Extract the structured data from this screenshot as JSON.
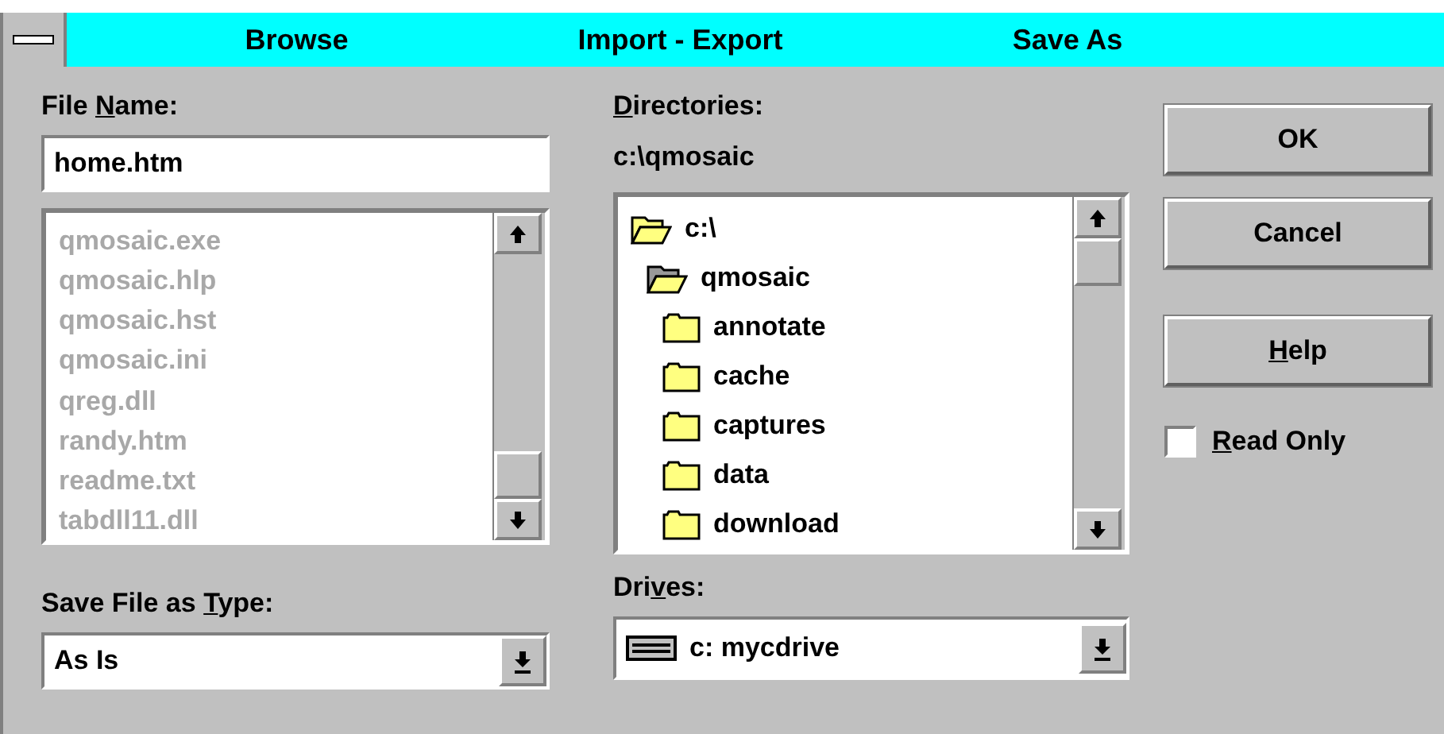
{
  "title_bar": {
    "items": [
      {
        "label": "Browse"
      },
      {
        "label": "Import - Export"
      },
      {
        "label": "Save As"
      }
    ]
  },
  "file_name": {
    "label": {
      "before": "File ",
      "key": "N",
      "after": "ame:"
    },
    "value": "home.htm"
  },
  "files": {
    "disabled": true,
    "items": [
      "qmosaic.exe",
      "qmosaic.hlp",
      "qmosaic.hst",
      "qmosaic.ini",
      "qreg.dll",
      "randy.htm",
      "readme.txt",
      "tabdll11.dll"
    ]
  },
  "save_type": {
    "label": {
      "before": "Save File as ",
      "key": "T",
      "after": "ype:"
    },
    "value": "As Is"
  },
  "directories": {
    "label": {
      "key": "D",
      "after": "irectories:"
    },
    "path": "c:\\qmosaic",
    "tree": [
      {
        "name": "c:\\",
        "kind": "open",
        "children": [
          {
            "name": "qmosaic",
            "kind": "current",
            "children": [
              {
                "name": "annotate",
                "kind": "closed"
              },
              {
                "name": "cache",
                "kind": "closed"
              },
              {
                "name": "captures",
                "kind": "closed"
              },
              {
                "name": "data",
                "kind": "closed"
              },
              {
                "name": "download",
                "kind": "closed"
              }
            ]
          }
        ]
      }
    ]
  },
  "drives": {
    "label": {
      "before": "Dri",
      "key": "v",
      "after": "es:"
    },
    "value": "c: mycdrive"
  },
  "buttons": [
    {
      "label": {
        "after": "OK"
      }
    },
    {
      "label": {
        "after": "Cancel"
      }
    },
    {
      "label": {
        "key": "H",
        "after": "elp"
      }
    }
  ],
  "read_only": {
    "label": {
      "key": "R",
      "after": "ead Only"
    },
    "checked": false
  }
}
